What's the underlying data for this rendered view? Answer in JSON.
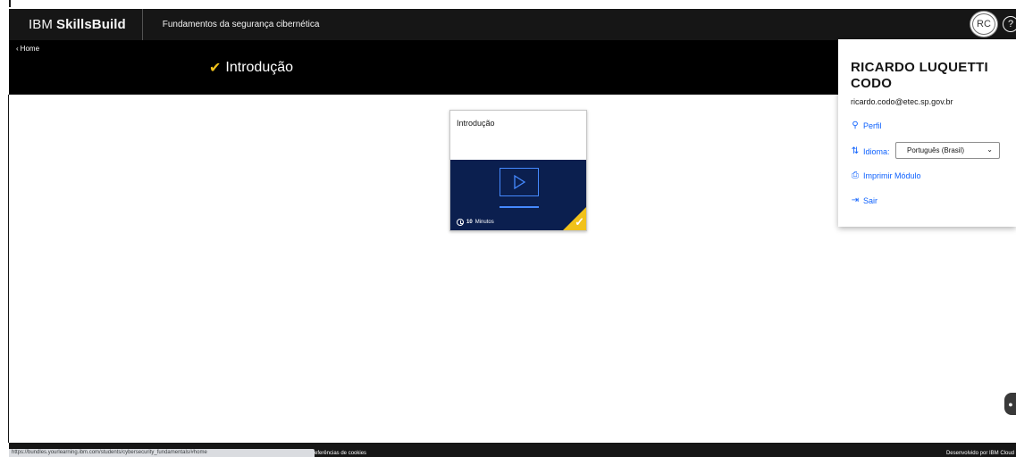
{
  "header": {
    "brand_prefix": "IBM",
    "brand_name": "SkillsBuild",
    "course_title": "Fundamentos da segurança cibernética",
    "avatar_initials": "RC",
    "help_icon": "help-circle-icon"
  },
  "subheader": {
    "back_label": "Home",
    "page_title": "Introdução",
    "title_icon": "checkmark-icon"
  },
  "card": {
    "title": "Introdução",
    "duration_value": "10",
    "duration_unit": "Minutos",
    "media_icon": "play-video-icon",
    "status_icon": "completed-checkmark-icon",
    "accent_color": "#f1c21b",
    "media_color": "#0b1f4f"
  },
  "profile_menu": {
    "name": "RICARDO LUQUETTI CODO",
    "email": "ricardo.codo@etec.sp.gov.br",
    "items": [
      {
        "label": "Perfil",
        "icon": "user-profile-icon"
      },
      {
        "label": "Idioma:",
        "icon": "language-icon"
      },
      {
        "label": "Imprimir Módulo",
        "icon": "printer-icon"
      },
      {
        "label": "Sair",
        "icon": "logout-icon"
      }
    ],
    "language_selected": "Português (Brasil)"
  },
  "footer": {
    "status_url": "https://bundles.yourlearning.ibm.com/students/cybersecurity_fundamentals/#home",
    "cookies_label": "eferências de cookies",
    "developed_by": "Desenvolvido por IBM Cloud"
  },
  "colors": {
    "link": "#0f62fe",
    "header_bg": "#161616",
    "subheader_bg": "#000000"
  }
}
